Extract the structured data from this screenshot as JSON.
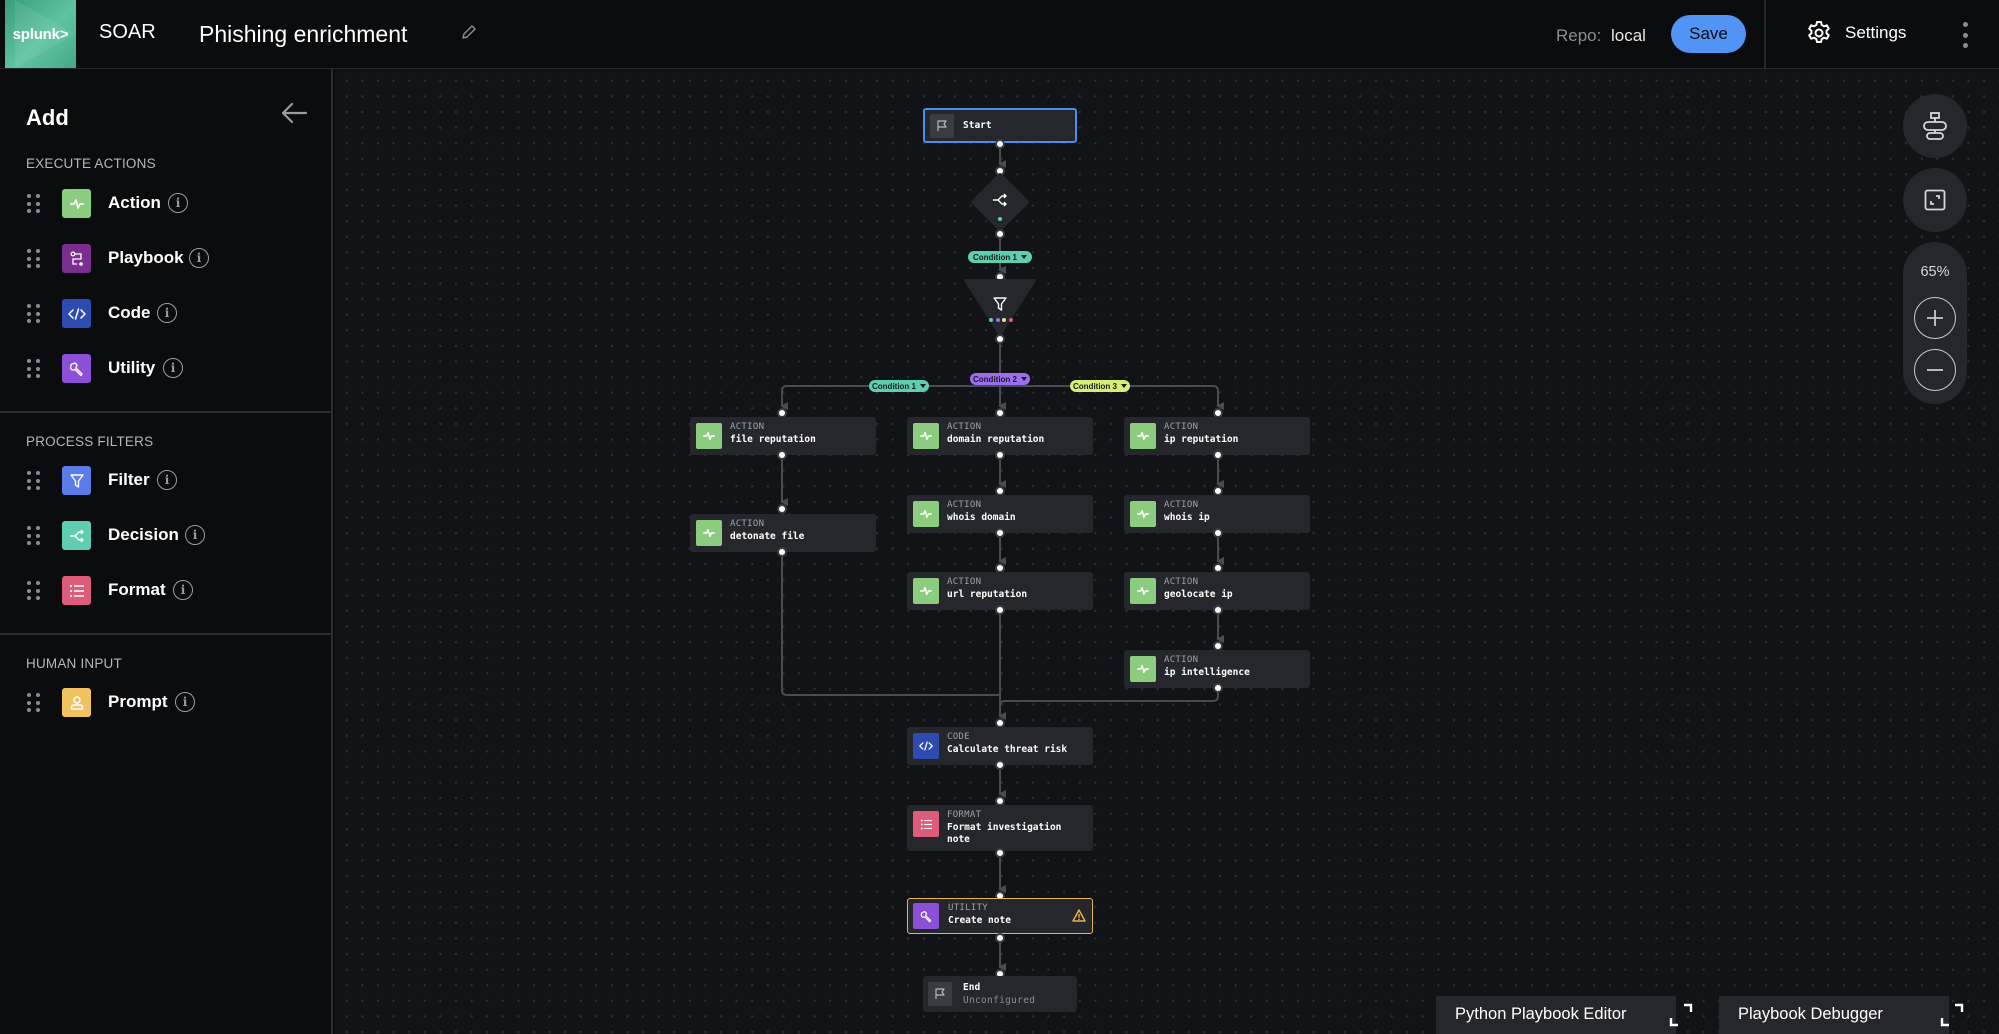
{
  "header": {
    "logo_text": "splunk>",
    "app_name": "SOAR",
    "playbook_title": "Phishing enrichment",
    "repo_label": "Repo:",
    "repo_value": "local",
    "save_label": "Save",
    "settings_label": "Settings"
  },
  "sidebar": {
    "title": "Add",
    "sections": [
      {
        "title": "EXECUTE ACTIONS",
        "items": [
          {
            "label": "Action",
            "icon": "action-pulse-icon",
            "color": "#8ccc7e"
          },
          {
            "label": "Playbook",
            "icon": "playbook-icon",
            "color": "#7b2e8e"
          },
          {
            "label": "Code",
            "icon": "code-icon",
            "color": "#2e4bb0"
          },
          {
            "label": "Utility",
            "icon": "wrench-icon",
            "color": "#8c4fd8"
          }
        ]
      },
      {
        "title": "PROCESS FILTERS",
        "items": [
          {
            "label": "Filter",
            "icon": "funnel-icon",
            "color": "#5a7be8"
          },
          {
            "label": "Decision",
            "icon": "decision-split-icon",
            "color": "#5fcdb0"
          },
          {
            "label": "Format",
            "icon": "list-icon",
            "color": "#dc5c7a"
          }
        ]
      },
      {
        "title": "HUMAN INPUT",
        "items": [
          {
            "label": "Prompt",
            "icon": "person-icon",
            "color": "#f0c260"
          }
        ]
      }
    ]
  },
  "canvas": {
    "zoom_level": "65%",
    "nodes": {
      "start": {
        "name": "Start"
      },
      "file_reputation": {
        "type": "ACTION",
        "name": "file reputation"
      },
      "detonate_file": {
        "type": "ACTION",
        "name": "detonate file"
      },
      "domain_reputation": {
        "type": "ACTION",
        "name": "domain reputation"
      },
      "whois_domain": {
        "type": "ACTION",
        "name": "whois domain"
      },
      "url_reputation": {
        "type": "ACTION",
        "name": "url reputation"
      },
      "ip_reputation": {
        "type": "ACTION",
        "name": "ip reputation"
      },
      "whois_ip": {
        "type": "ACTION",
        "name": "whois ip"
      },
      "geolocate_ip": {
        "type": "ACTION",
        "name": "geolocate ip"
      },
      "ip_intelligence": {
        "type": "ACTION",
        "name": "ip intelligence"
      },
      "calc_risk": {
        "type": "CODE",
        "name": "Calculate threat risk"
      },
      "format_note_line1": "Format investigation",
      "format_note_line2": "note",
      "format_note": {
        "type": "FORMAT"
      },
      "create_note": {
        "type": "UTILITY",
        "name": "Create note",
        "status": "warning"
      },
      "end": {
        "name": "End",
        "status": "Unconfigured"
      }
    },
    "conditions": {
      "decision_cond1": {
        "label": "Condition 1",
        "color": "#5fcdb0"
      },
      "filter_cond1": {
        "label": "Condition 1",
        "color": "#5fcdb0"
      },
      "filter_cond2": {
        "label": "Condition 2",
        "color": "#9b6df0"
      },
      "filter_cond3": {
        "label": "Condition 3",
        "color": "#d8ec78"
      }
    },
    "filter_dots": [
      "#5fcdb0",
      "#9b6df0",
      "#d8ec78",
      "#dc5c7a"
    ]
  },
  "bottom_panels": {
    "python_editor": "Python Playbook Editor",
    "debugger": "Playbook Debugger"
  },
  "colors": {
    "accent": "#5294f5",
    "warning": "#e9b44c"
  }
}
